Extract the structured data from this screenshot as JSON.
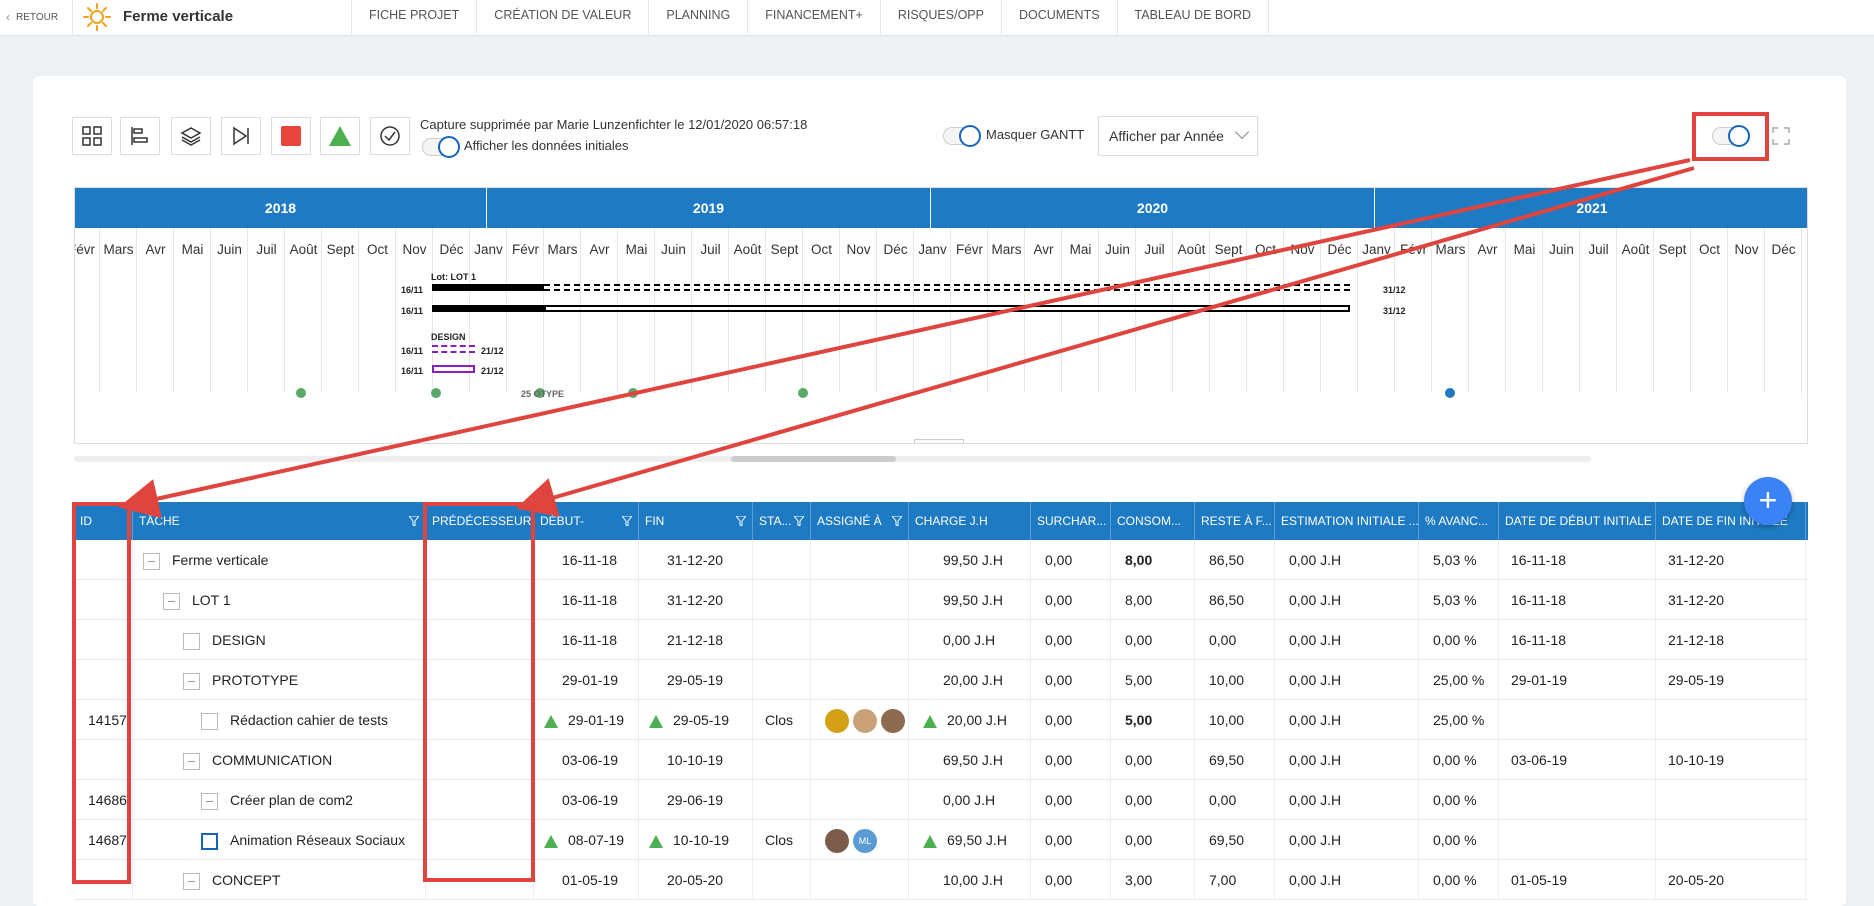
{
  "topbar": {
    "back_label": "RETOUR",
    "project_title": "Ferme verticale",
    "tabs": [
      "FICHE PROJET",
      "CRÉATION DE VALEUR",
      "PLANNING",
      "FINANCEMENT+",
      "RISQUES/OPP",
      "DOCUMENTS",
      "TABLEAU DE BORD"
    ]
  },
  "toolbar": {
    "capture_text": "Capture supprimée par Marie Lunzenfichter le 12/01/2020 06:57:18",
    "initial_data_label": "Afficher les données initiales",
    "mask_gantt_label": "Masquer GANTT",
    "view_select_value": "Afficher par Année",
    "colors": {
      "stop": "#e8453c",
      "milestone": "#4caf50",
      "accent": "#1e7bc3",
      "annotation": "#e0443e"
    }
  },
  "gantt": {
    "years": [
      "2018",
      "2019",
      "2020",
      "2021"
    ],
    "months": [
      "Févr",
      "Mars",
      "Avr",
      "Mai",
      "Juin",
      "Juil",
      "Août",
      "Sept",
      "Oct",
      "Nov",
      "Déc",
      "Janv",
      "Févr",
      "Mars",
      "Avr",
      "Mai",
      "Juin",
      "Juil",
      "Août",
      "Sept",
      "Oct",
      "Nov",
      "Déc",
      "Janv",
      "Févr",
      "Mars",
      "Avr",
      "Mai",
      "Juin",
      "Juil",
      "Août",
      "Sept",
      "Oct",
      "Nov",
      "Déc",
      "Janv",
      "Févr",
      "Mars",
      "Avr",
      "Mai",
      "Juin",
      "Juil",
      "Août",
      "Sept",
      "Oct",
      "Nov",
      "Déc"
    ],
    "lot_label": "Lot: LOT 1",
    "design_label": "DESIGN",
    "start_date": "16/11",
    "lot_end_date": "31/12",
    "design_end_date": "21/12",
    "cut_text": "25 OTYPE"
  },
  "grid": {
    "columns": [
      "ID",
      "TÂCHE",
      "PRÉDÉCESSEUR",
      "DÉBUT-",
      "FIN",
      "STA...",
      "ASSIGNÉ À",
      "CHARGE J.H",
      "SURCHAR...",
      "CONSOM...",
      "RESTE À F...",
      "ESTIMATION INITIALE ...",
      "% AVANC...",
      "DATE DE DÉBUT INITIALE",
      "DATE DE FIN INITIALE"
    ],
    "rows": [
      {
        "id": "",
        "task": "Ferme verticale",
        "start": "16-11-18",
        "end": "31-12-20",
        "status": "",
        "charge": "99,50 J.H",
        "surcharge": "0,00",
        "consom": "8,00",
        "reste": "86,50",
        "estim": "0,00 J.H",
        "avanc": "5,03 %",
        "dstart": "16-11-18",
        "dend": "31-12-20"
      },
      {
        "id": "",
        "task": "LOT 1",
        "start": "16-11-18",
        "end": "31-12-20",
        "status": "",
        "charge": "99,50 J.H",
        "surcharge": "0,00",
        "consom": "8,00",
        "reste": "86,50",
        "estim": "0,00 J.H",
        "avanc": "5,03 %",
        "dstart": "16-11-18",
        "dend": "31-12-20"
      },
      {
        "id": "",
        "task": "DESIGN",
        "start": "16-11-18",
        "end": "21-12-18",
        "status": "",
        "charge": "0,00 J.H",
        "surcharge": "0,00",
        "consom": "0,00",
        "reste": "0,00",
        "estim": "0,00 J.H",
        "avanc": "0,00 %",
        "dstart": "16-11-18",
        "dend": "21-12-18"
      },
      {
        "id": "",
        "task": "PROTOTYPE",
        "start": "29-01-19",
        "end": "29-05-19",
        "status": "",
        "charge": "20,00 J.H",
        "surcharge": "0,00",
        "consom": "5,00",
        "reste": "10,00",
        "estim": "0,00 J.H",
        "avanc": "25,00 %",
        "dstart": "29-01-19",
        "dend": "29-05-19"
      },
      {
        "id": "14157",
        "task": "Rédaction cahier de tests",
        "start": "29-01-19",
        "end": "29-05-19",
        "status": "Clos",
        "charge": "20,00 J.H",
        "surcharge": "0,00",
        "consom": "5,00",
        "reste": "10,00",
        "estim": "0,00 J.H",
        "avanc": "25,00 %",
        "dstart": "",
        "dend": ""
      },
      {
        "id": "",
        "task": "COMMUNICATION",
        "start": "03-06-19",
        "end": "10-10-19",
        "status": "",
        "charge": "69,50 J.H",
        "surcharge": "0,00",
        "consom": "0,00",
        "reste": "69,50",
        "estim": "0,00 J.H",
        "avanc": "0,00 %",
        "dstart": "03-06-19",
        "dend": "10-10-19"
      },
      {
        "id": "14686",
        "task": "Créer plan de com2",
        "start": "03-06-19",
        "end": "29-06-19",
        "status": "",
        "charge": "0,00 J.H",
        "surcharge": "0,00",
        "consom": "0,00",
        "reste": "0,00",
        "estim": "0,00 J.H",
        "avanc": "0,00 %",
        "dstart": "",
        "dend": ""
      },
      {
        "id": "14687",
        "task": "Animation Réseaux Sociaux",
        "start": "08-07-19",
        "end": "10-10-19",
        "status": "Clos",
        "charge": "69,50 J.H",
        "surcharge": "0,00",
        "consom": "0,00",
        "reste": "69,50",
        "estim": "0,00 J.H",
        "avanc": "0,00 %",
        "dstart": "",
        "dend": ""
      },
      {
        "id": "",
        "task": "CONCEPT",
        "start": "01-05-19",
        "end": "20-05-20",
        "status": "",
        "charge": "10,00 J.H",
        "surcharge": "0,00",
        "consom": "3,00",
        "reste": "7,00",
        "estim": "0,00 J.H",
        "avanc": "0,00 %",
        "dstart": "01-05-19",
        "dend": "20-05-20"
      }
    ],
    "avatar_initials": "ML"
  },
  "fab_label": "+"
}
